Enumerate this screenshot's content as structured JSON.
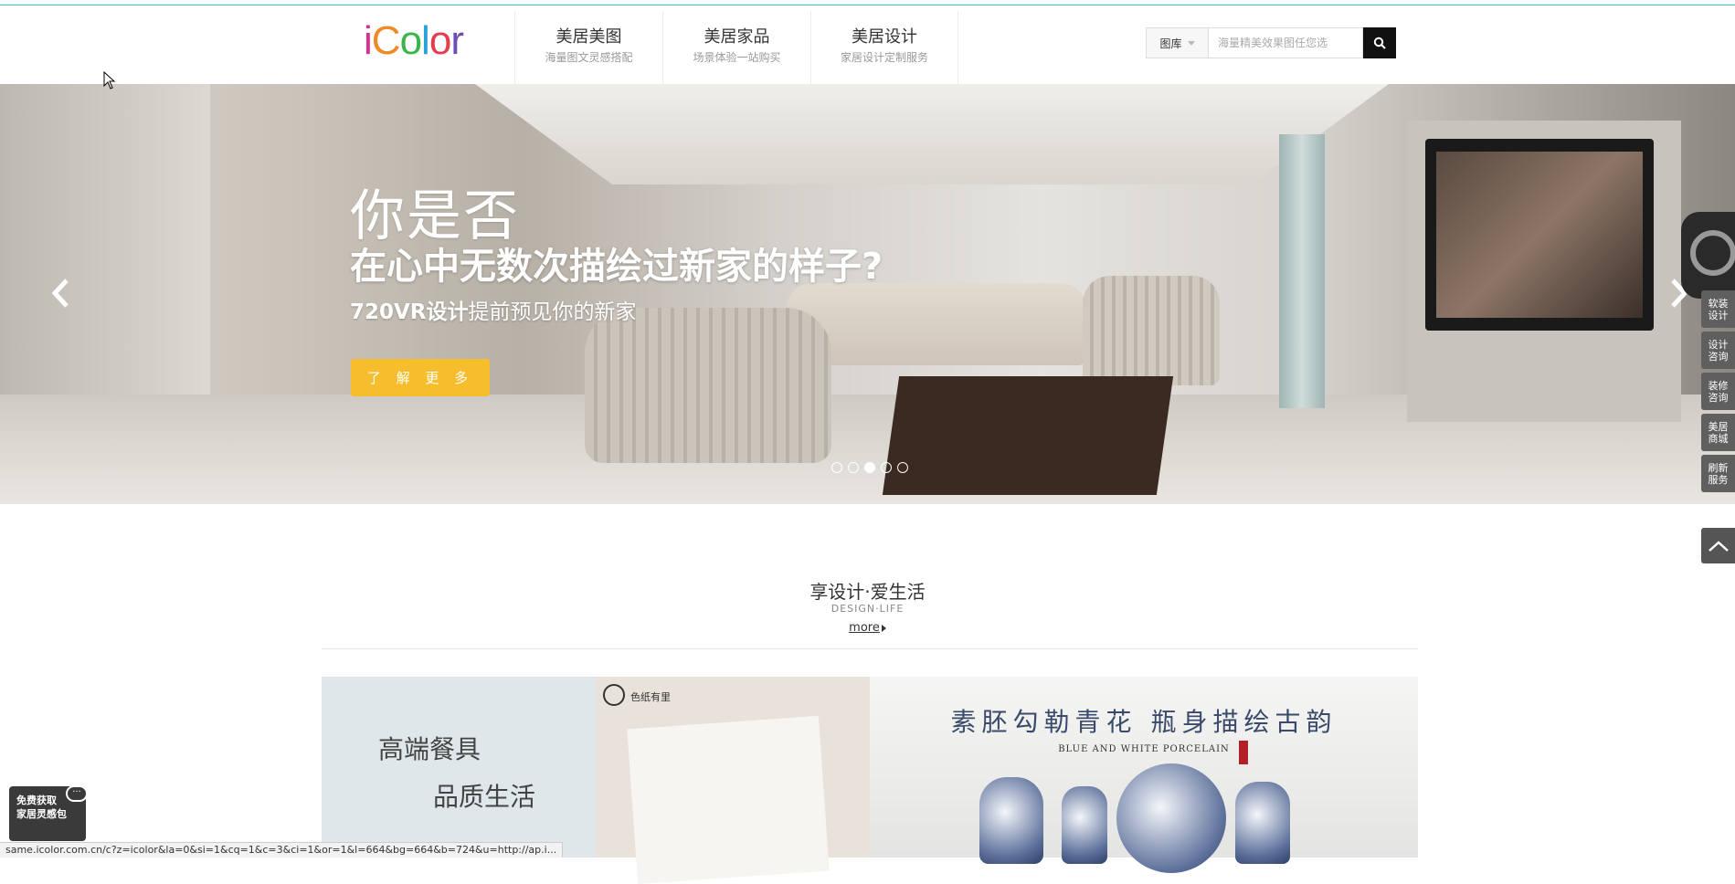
{
  "header": {
    "logo_text": "iColor",
    "logo_colors": [
      "#d9308c",
      "#f08a24",
      "#39b54a",
      "#2aa3d9",
      "#e43d4f",
      "#6b4fb3"
    ],
    "nav": [
      {
        "title": "美居美图",
        "subtitle": "海量图文灵感搭配"
      },
      {
        "title": "美居家品",
        "subtitle": "场景体验一站购买"
      },
      {
        "title": "美居设计",
        "subtitle": "家居设计定制服务"
      }
    ],
    "search": {
      "category": "图库",
      "placeholder": "海量精美效果图任您选"
    }
  },
  "banner": {
    "line1": "你是否",
    "line2": "在心中无数次描绘过新家的样子?",
    "line3_bold": "720VR设计",
    "line3_rest": "提前预见你的新家",
    "cta": "了 解 更 多",
    "cta_color": "#f6bd2c",
    "slide_count": 5,
    "active_slide": 3
  },
  "sidebar": {
    "items": [
      "软装\n设计",
      "设计\n咨询",
      "装修\n咨询",
      "美居\n商城",
      "刷新\n服务"
    ]
  },
  "section": {
    "title": "享设计·爱生活",
    "subtitle": "DESIGN·LIFE",
    "more": "more"
  },
  "cards": {
    "card1_line1": "高端餐具",
    "card1_line2": "品质生活",
    "card2_brand": "色纸有里",
    "card3_title": "素胚勾勒青花 瓶身描绘古韵",
    "card3_sub": "BLUE AND WHITE PORCELAIN"
  },
  "promo": {
    "text": "免费获取\n家居灵感包",
    "bubble": "···"
  },
  "status_bar": "same.icolor.com.cn/c?z=icolor&la=0&si=1&cq=1&c=3&ci=1&or=1&l=664&bg=664&b=724&u=http://ap.i..."
}
